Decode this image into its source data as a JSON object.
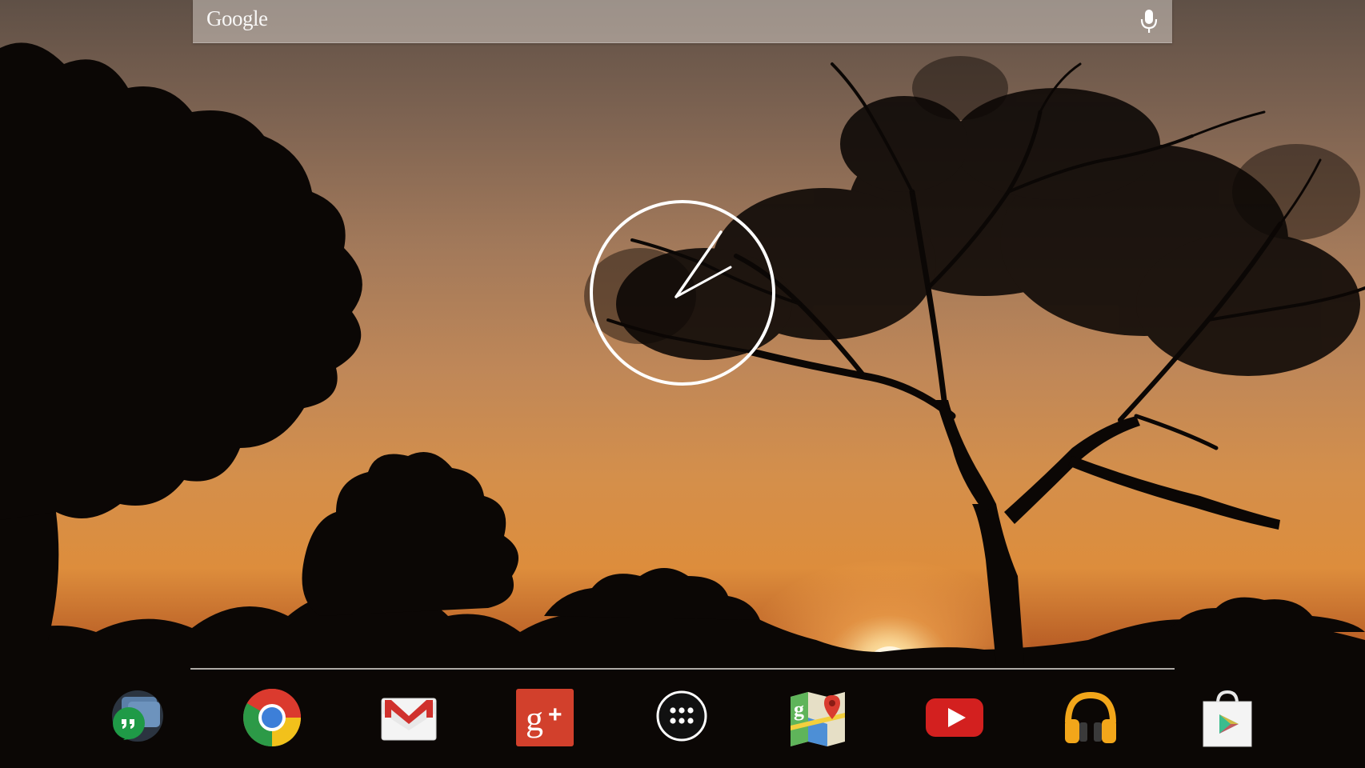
{
  "search": {
    "label": "Google",
    "icon": "mic-icon"
  },
  "clock": {
    "type": "analog",
    "time_hour_hand_deg": 32,
    "time_minute_hand_deg": 28
  },
  "dock": {
    "apps": [
      {
        "name": "hangouts",
        "icon": "hangouts-icon"
      },
      {
        "name": "chrome",
        "icon": "chrome-icon"
      },
      {
        "name": "gmail",
        "icon": "gmail-icon"
      },
      {
        "name": "google-plus",
        "icon": "google-plus-icon"
      },
      {
        "name": "all-apps",
        "icon": "app-drawer-icon"
      },
      {
        "name": "maps",
        "icon": "maps-icon"
      },
      {
        "name": "youtube",
        "icon": "youtube-icon"
      },
      {
        "name": "play-music",
        "icon": "headphones-icon"
      },
      {
        "name": "play-store",
        "icon": "play-store-icon"
      }
    ]
  },
  "colors": {
    "sky_top": "#5f5046",
    "sky_horizon": "#dd8d3c",
    "silhouette": "#0b0705"
  }
}
